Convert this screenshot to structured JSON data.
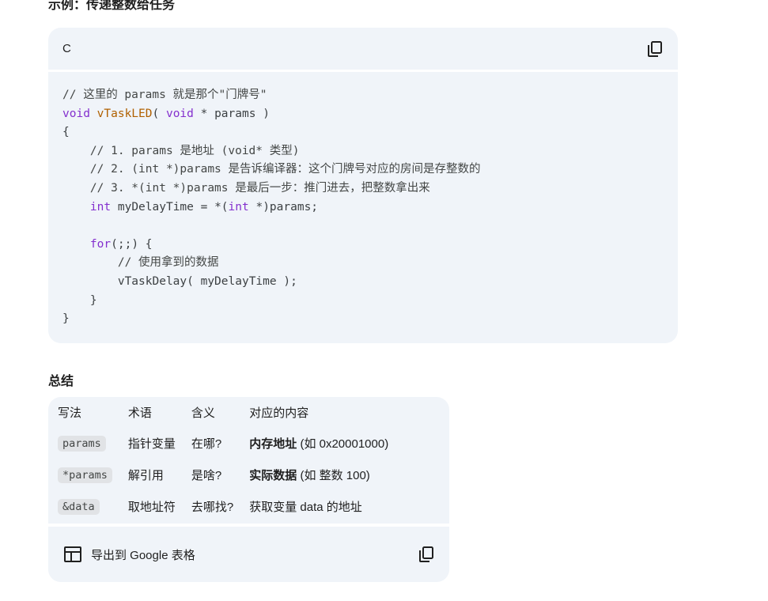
{
  "section_heading": "示例：传递整数给任务",
  "code_block": {
    "language": "C",
    "copy_icon": "copy-icon",
    "lines": {
      "l1": "// 这里的 params 就是那个\"门牌号\"",
      "l2_kw": "void",
      "l2_fn": "vTaskLED",
      "l2_open": "( ",
      "l2_kw2": "void",
      "l2_rest": " * params )",
      "l3": "{",
      "l4": "    // 1. params 是地址 (void* 类型)",
      "l5": "    // 2. (int *)params 是告诉编译器：这个门牌号对应的房间是存整数的",
      "l6": "    // 3. *(int *)params 是最后一步：推门进去，把整数拿出来",
      "l7_indent": "    ",
      "l7_kw": "int",
      "l7_mid": " myDelayTime = *(",
      "l7_kw2": "int",
      "l7_end": " *)params;",
      "l8": "",
      "l9_indent": "    ",
      "l9_kw": "for",
      "l9_rest": "(;;) {",
      "l10": "        // 使用拿到的数据",
      "l11": "        vTaskDelay( myDelayTime );",
      "l12": "    }",
      "l13": "}"
    }
  },
  "summary": {
    "title": "总结",
    "headers": [
      "写法",
      "术语",
      "含义",
      "对应的内容"
    ],
    "rows": [
      {
        "code": "params",
        "term": "指针变量",
        "meaning": "在哪?",
        "content_bold": "内存地址",
        "content_rest": " (如 0x20001000)"
      },
      {
        "code": "*params",
        "term": "解引用",
        "meaning": "是啥?",
        "content_bold": "实际数据",
        "content_rest": " (如 整数 100)"
      },
      {
        "code": "&data",
        "term": "取地址符",
        "meaning": "去哪找?",
        "content_bold": "",
        "content_rest": "获取变量 data 的地址"
      }
    ],
    "export_label": "导出到 Google 表格",
    "export_icon": "table-grid-icon",
    "copy_icon": "copy-icon"
  }
}
